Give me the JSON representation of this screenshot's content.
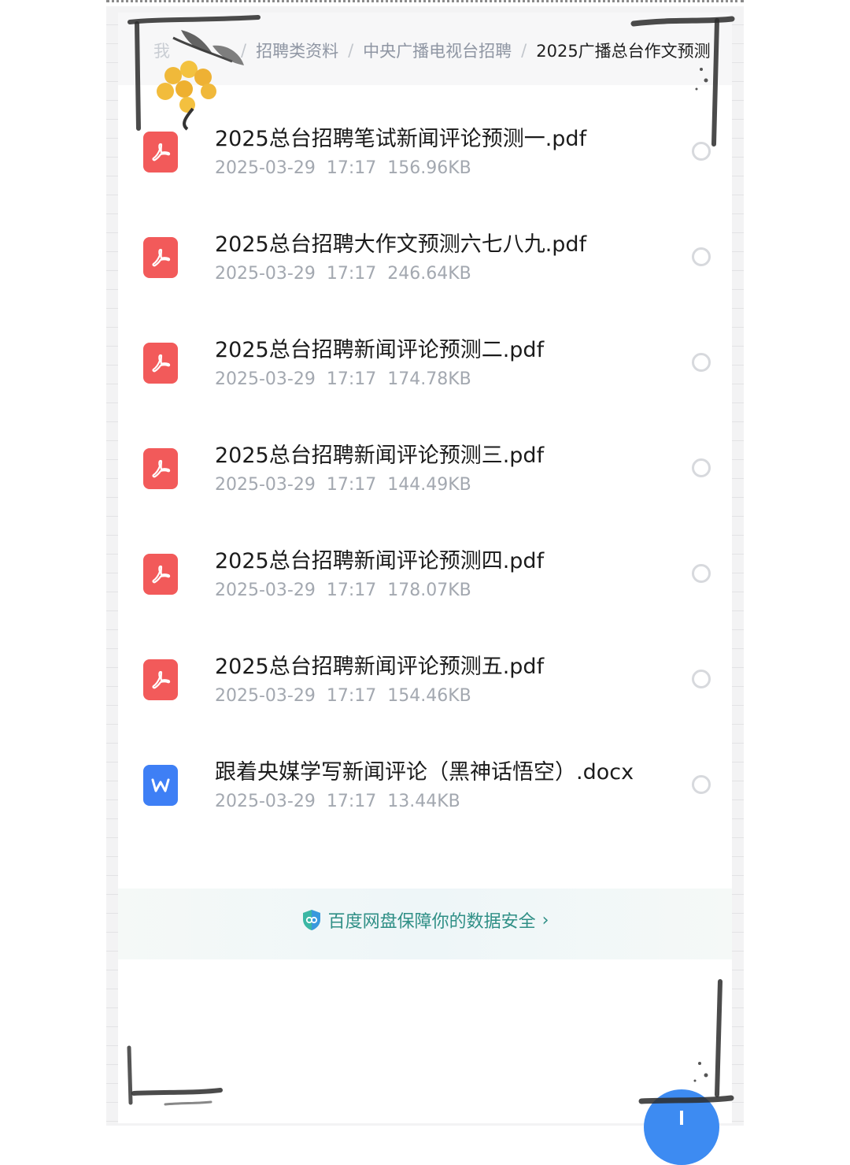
{
  "breadcrumb": {
    "items": [
      "我",
      "招聘类资料",
      "中央广播电视台招聘",
      "2025广播总台作文预测"
    ],
    "separator": "/"
  },
  "files": [
    {
      "name": "2025总台招聘笔试新闻评论预测一.pdf",
      "date": "2025-03-29",
      "time": "17:17",
      "size": "156.96KB",
      "type": "pdf"
    },
    {
      "name": "2025总台招聘大作文预测六七八九.pdf",
      "date": "2025-03-29",
      "time": "17:17",
      "size": "246.64KB",
      "type": "pdf"
    },
    {
      "name": "2025总台招聘新闻评论预测二.pdf",
      "date": "2025-03-29",
      "time": "17:17",
      "size": "174.78KB",
      "type": "pdf"
    },
    {
      "name": "2025总台招聘新闻评论预测三.pdf",
      "date": "2025-03-29",
      "time": "17:17",
      "size": "144.49KB",
      "type": "pdf"
    },
    {
      "name": "2025总台招聘新闻评论预测四.pdf",
      "date": "2025-03-29",
      "time": "17:17",
      "size": "178.07KB",
      "type": "pdf"
    },
    {
      "name": "2025总台招聘新闻评论预测五.pdf",
      "date": "2025-03-29",
      "time": "17:17",
      "size": "154.46KB",
      "type": "pdf"
    },
    {
      "name": "跟着央媒学写新闻评论（黑神话悟空）.docx",
      "date": "2025-03-29",
      "time": "17:17",
      "size": "13.44KB",
      "type": "docx"
    }
  ],
  "icons": {
    "pdf": "pdf-file-icon",
    "docx": "word-file-icon",
    "shield": "shield-icon",
    "chevron": "chevron-right-icon"
  },
  "notice": {
    "text": "百度网盘保障你的数据安全",
    "chevron": "›"
  },
  "colors": {
    "pdf_icon": "#f25a5a",
    "doc_icon": "#3e7ff5",
    "notice_text": "#2f8f86",
    "fab": "#3d8bf2"
  }
}
